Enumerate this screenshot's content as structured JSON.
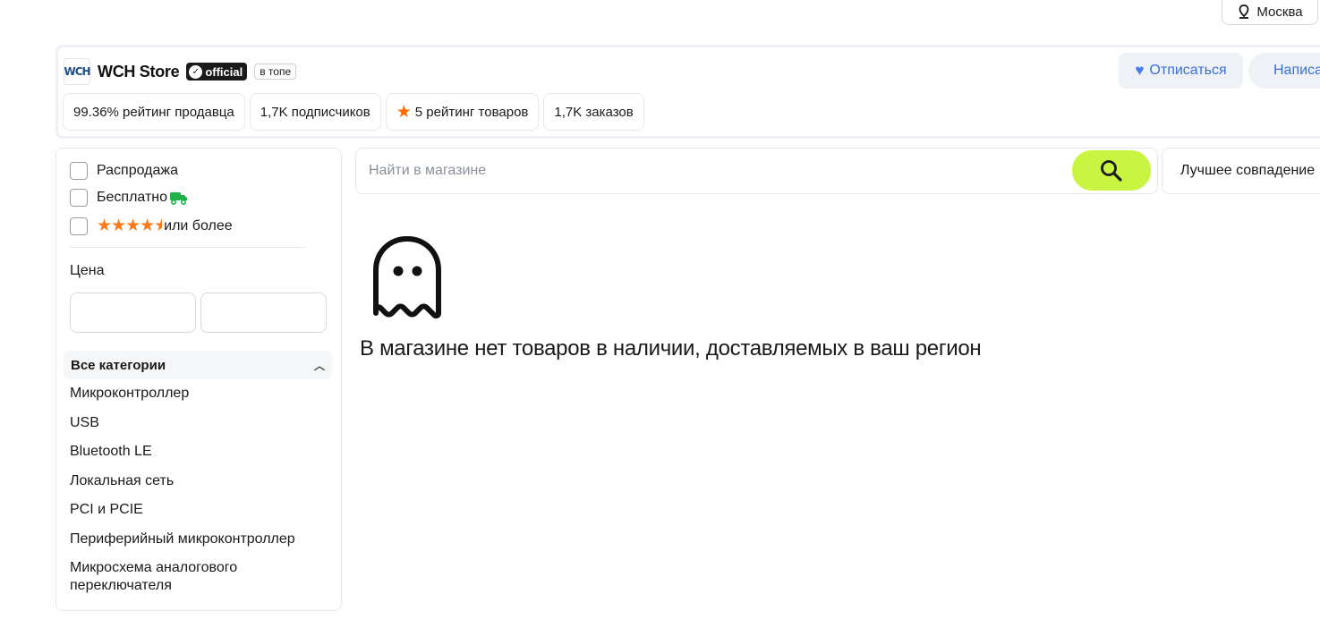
{
  "location": {
    "label": "Москва",
    "icon": "location-pin-icon"
  },
  "store": {
    "logo_text": "WCH",
    "name": "WCH Store",
    "official_label": "official",
    "top_badge": "в топе",
    "stats": [
      {
        "text": "99.36% рейтинг продавца"
      },
      {
        "text": "1,7K подписчиков"
      },
      {
        "text": "5 рейтинг товаров",
        "icon": "star-icon"
      },
      {
        "text": "1,7K заказов"
      }
    ],
    "unsubscribe_label": "Отписаться",
    "write_label": "Написать"
  },
  "filters": {
    "sale_label": "Распродажа",
    "free_label": "Бесплатно",
    "rating_label": "или более",
    "rating_stars": 4.5,
    "price_label": "Цена",
    "price_from": "",
    "price_to": ""
  },
  "categories": {
    "header": "Все категории",
    "items": [
      "Микроконтроллер",
      "USB",
      "Bluetooth LE",
      "Локальная сеть",
      "PCI и PCIE",
      "Периферийный микроконтроллер",
      "Микросхема аналогового переключателя"
    ]
  },
  "search": {
    "placeholder": "Найти в магазине",
    "value": ""
  },
  "sort": {
    "selected": "Лучшее совпадение"
  },
  "empty_state": {
    "message": "В магазине нет товаров в наличии, доставляемых в ваш регион"
  },
  "colors": {
    "accent_green": "#c9f542",
    "link_blue": "#3a6fd8",
    "star_orange": "#ff7a1a",
    "truck_green": "#1fb24a"
  }
}
